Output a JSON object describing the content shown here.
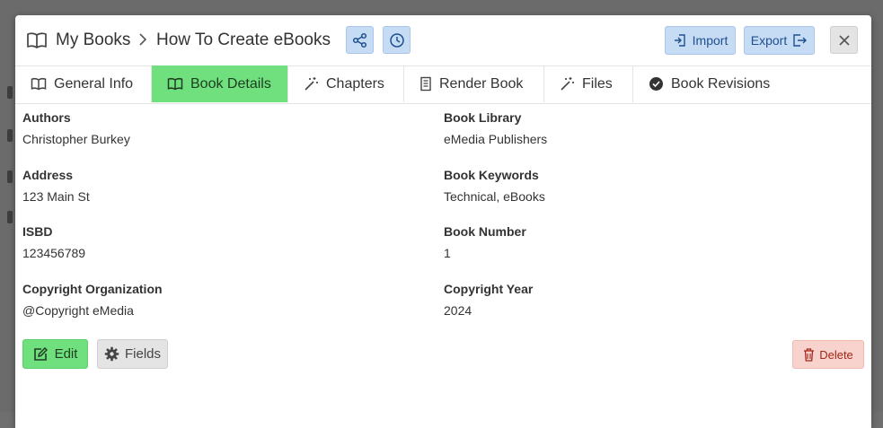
{
  "breadcrumb": {
    "root": "My Books",
    "current": "How To Create eBooks"
  },
  "header": {
    "share_icon": "share-icon",
    "history_icon": "clock-icon",
    "import_label": "Import",
    "export_label": "Export"
  },
  "tabs": [
    {
      "label": "General Info",
      "icon": "book-open-icon",
      "active": false
    },
    {
      "label": "Book Details",
      "icon": "book-open-icon",
      "active": true
    },
    {
      "label": "Chapters",
      "icon": "magic-wand-icon",
      "active": false
    },
    {
      "label": "Render Book",
      "icon": "document-icon",
      "active": false
    },
    {
      "label": "Files",
      "icon": "magic-wand-icon",
      "active": false
    },
    {
      "label": "Book Revisions",
      "icon": "check-badge-icon",
      "active": false
    }
  ],
  "fields": {
    "authors": {
      "label": "Authors",
      "value": "Christopher Burkey"
    },
    "book_library": {
      "label": "Book Library",
      "value": "eMedia Publishers"
    },
    "address": {
      "label": "Address",
      "value": "123 Main St"
    },
    "book_keywords": {
      "label": "Book Keywords",
      "value": "Technical, eBooks"
    },
    "isbd": {
      "label": "ISBD",
      "value": "123456789"
    },
    "book_number": {
      "label": "Book Number",
      "value": "1"
    },
    "copyright_org": {
      "label": "Copyright Organization",
      "value": "@Copyright eMedia"
    },
    "copyright_year": {
      "label": "Copyright Year",
      "value": "2024"
    }
  },
  "actions": {
    "edit_label": "Edit",
    "fields_label": "Fields",
    "delete_label": "Delete"
  },
  "colors": {
    "active_tab": "#6fe07d",
    "primary_button_bg": "#c6dcf5",
    "primary_button_text": "#1f4f8f",
    "delete_bg": "#f8d2cc",
    "delete_text": "#a3271a"
  }
}
